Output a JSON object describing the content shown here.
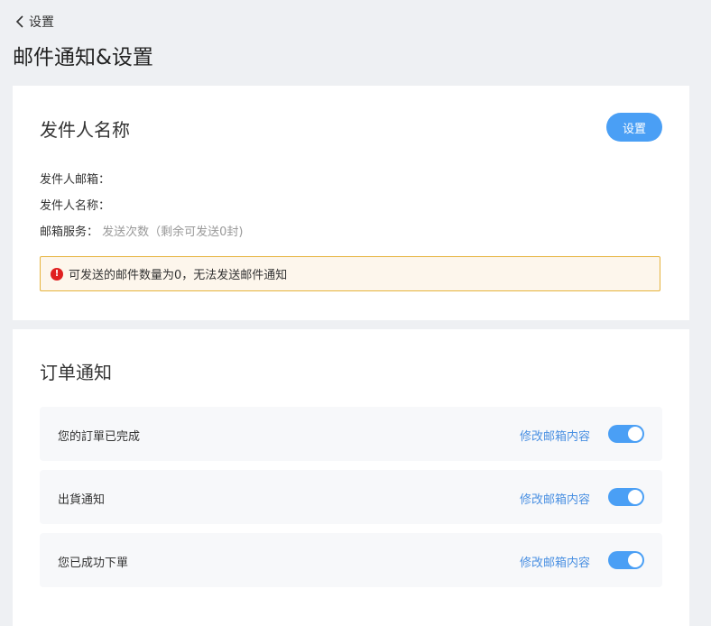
{
  "header": {
    "back_label": "设置",
    "page_title": "邮件通知&设置"
  },
  "sender_card": {
    "title": "发件人名称",
    "set_button": "设置",
    "email_label": "发件人邮箱：",
    "name_label": "发件人名称：",
    "service_label": "邮箱服务：",
    "service_value": "发送次数（剩余可发送0封)",
    "alert_icon": "!",
    "alert_text": "可发送的邮件数量为0，无法发送邮件通知"
  },
  "order_card": {
    "title": "订单通知",
    "items": [
      {
        "label": "您的訂單已完成",
        "edit_label": "修改邮箱内容",
        "enabled": true
      },
      {
        "label": "出貨通知",
        "edit_label": "修改邮箱内容",
        "enabled": true
      },
      {
        "label": "您已成功下單",
        "edit_label": "修改邮箱内容",
        "enabled": true
      }
    ]
  },
  "colors": {
    "accent": "#4a9ff5",
    "link": "#4a90e2",
    "alert_border": "#e6b33c",
    "alert_bg": "#fdf6ec",
    "error_icon": "#e02020"
  }
}
